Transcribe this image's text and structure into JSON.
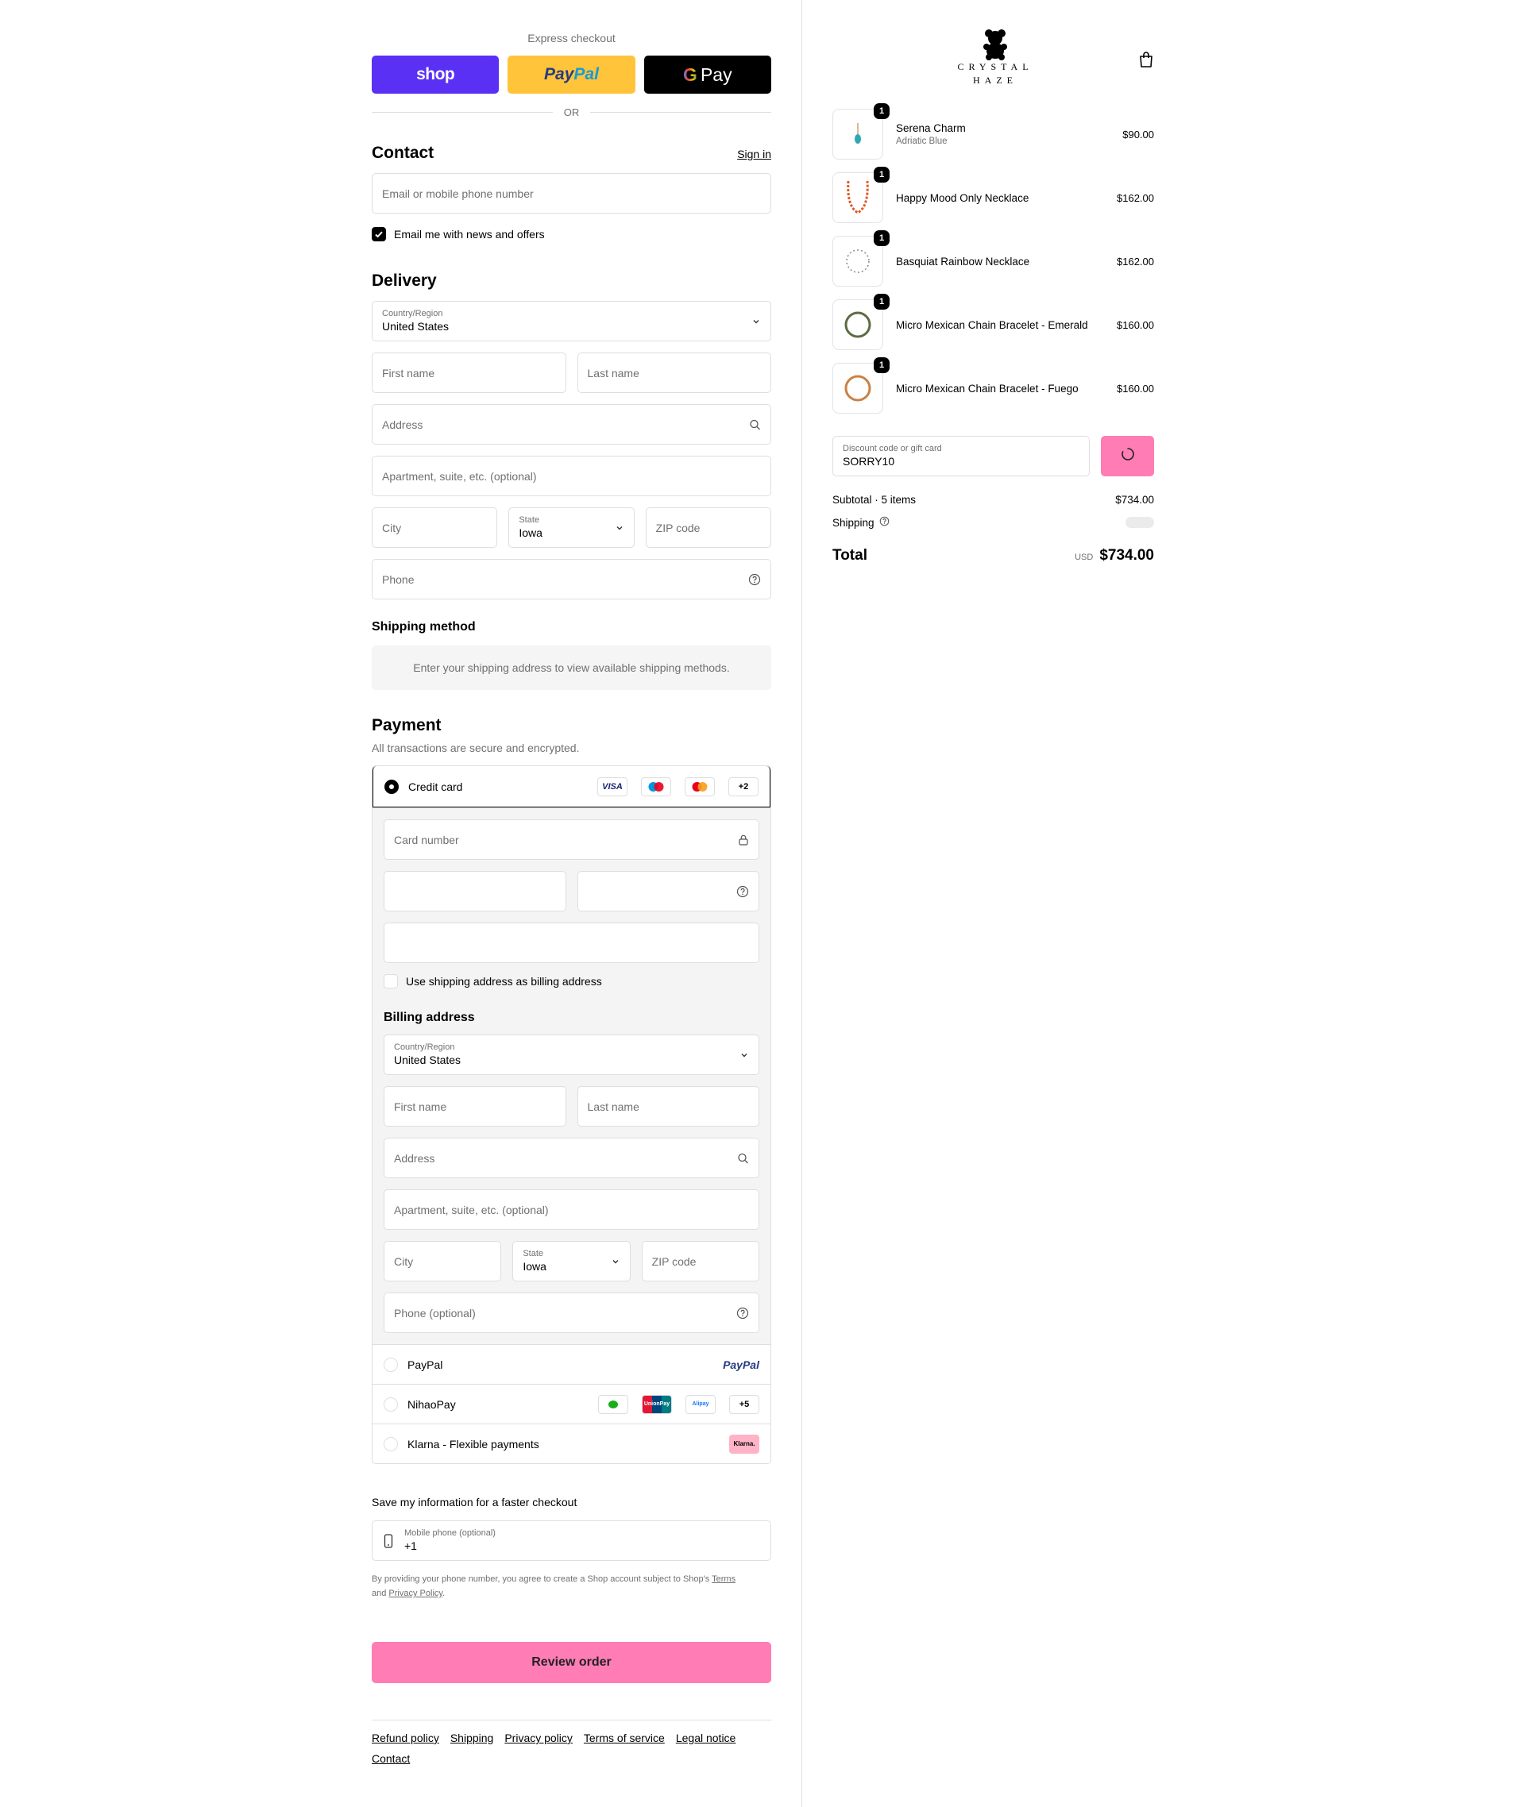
{
  "express": {
    "title": "Express checkout",
    "shop": "shop",
    "paypal_a": "Pay",
    "paypal_b": "Pal",
    "gpay_g": "G",
    "gpay": "Pay",
    "or": "OR"
  },
  "contact": {
    "heading": "Contact",
    "sign_in": "Sign in",
    "email_placeholder": "Email or mobile phone number",
    "news_label": "Email me with news and offers",
    "news_checked": true
  },
  "delivery": {
    "heading": "Delivery",
    "country_label": "Country/Region",
    "country_value": "United States",
    "first_name": "First name",
    "last_name": "Last name",
    "address": "Address",
    "apartment": "Apartment, suite, etc. (optional)",
    "city": "City",
    "state_label": "State",
    "state_value": "Iowa",
    "zip": "ZIP code",
    "phone": "Phone"
  },
  "shipping_method": {
    "heading": "Shipping method",
    "info": "Enter your shipping address to view available shipping methods."
  },
  "payment": {
    "heading": "Payment",
    "subtitle": "All transactions are secure and encrypted.",
    "credit_card": {
      "label": "Credit card",
      "badges": [
        "VISA",
        "maestro",
        "mastercard",
        "+2"
      ],
      "card_number": "Card number",
      "use_shipping": "Use shipping address as billing address"
    },
    "billing": {
      "heading": "Billing address",
      "country_label": "Country/Region",
      "country_value": "United States",
      "first_name": "First name",
      "last_name": "Last name",
      "address": "Address",
      "apartment": "Apartment, suite, etc. (optional)",
      "city": "City",
      "state_label": "State",
      "state_value": "Iowa",
      "zip": "ZIP code",
      "phone": "Phone (optional)"
    },
    "paypal": {
      "label": "PayPal",
      "logo": "PayPal"
    },
    "nihaopay": {
      "label": "NihaoPay",
      "more": "+5",
      "unionpay": "UnionPay",
      "alipay": "Alipay"
    },
    "klarna": {
      "label": "Klarna - Flexible payments",
      "logo": "Klarna."
    }
  },
  "save_info": {
    "title": "Save my information for a faster checkout",
    "mobile_label": "Mobile phone (optional)",
    "mobile_value": "+1",
    "legal_1": "By providing your phone number, you agree to create a Shop account subject to Shop's",
    "terms": "Terms",
    "and": "and",
    "privacy": "Privacy Policy",
    "period": "."
  },
  "review_button": "Review order",
  "footer_links": [
    "Refund policy",
    "Shipping",
    "Privacy policy",
    "Terms of service",
    "Legal notice",
    "Contact"
  ],
  "brand": {
    "line1": "CRYSTAL",
    "line2": "HAZE"
  },
  "cart": {
    "items": [
      {
        "qty": "1",
        "name": "Serena Charm",
        "variant": "Adriatic Blue",
        "price": "$90.00"
      },
      {
        "qty": "1",
        "name": "Happy Mood Only Necklace",
        "variant": "",
        "price": "$162.00"
      },
      {
        "qty": "1",
        "name": "Basquiat Rainbow Necklace",
        "variant": "",
        "price": "$162.00"
      },
      {
        "qty": "1",
        "name": "Micro Mexican Chain Bracelet - Emerald",
        "variant": "",
        "price": "$160.00"
      },
      {
        "qty": "1",
        "name": "Micro Mexican Chain Bracelet - Fuego",
        "variant": "",
        "price": "$160.00"
      }
    ],
    "discount_label": "Discount code or gift card",
    "discount_value": "SORRY10",
    "subtotal_label": "Subtotal · 5 items",
    "subtotal_value": "$734.00",
    "shipping_label": "Shipping",
    "total_label": "Total",
    "currency": "USD",
    "total_value": "$734.00"
  },
  "colors": {
    "accent": "#ff7db4",
    "shop": "#5a31f4",
    "paypal": "#ffc439"
  }
}
